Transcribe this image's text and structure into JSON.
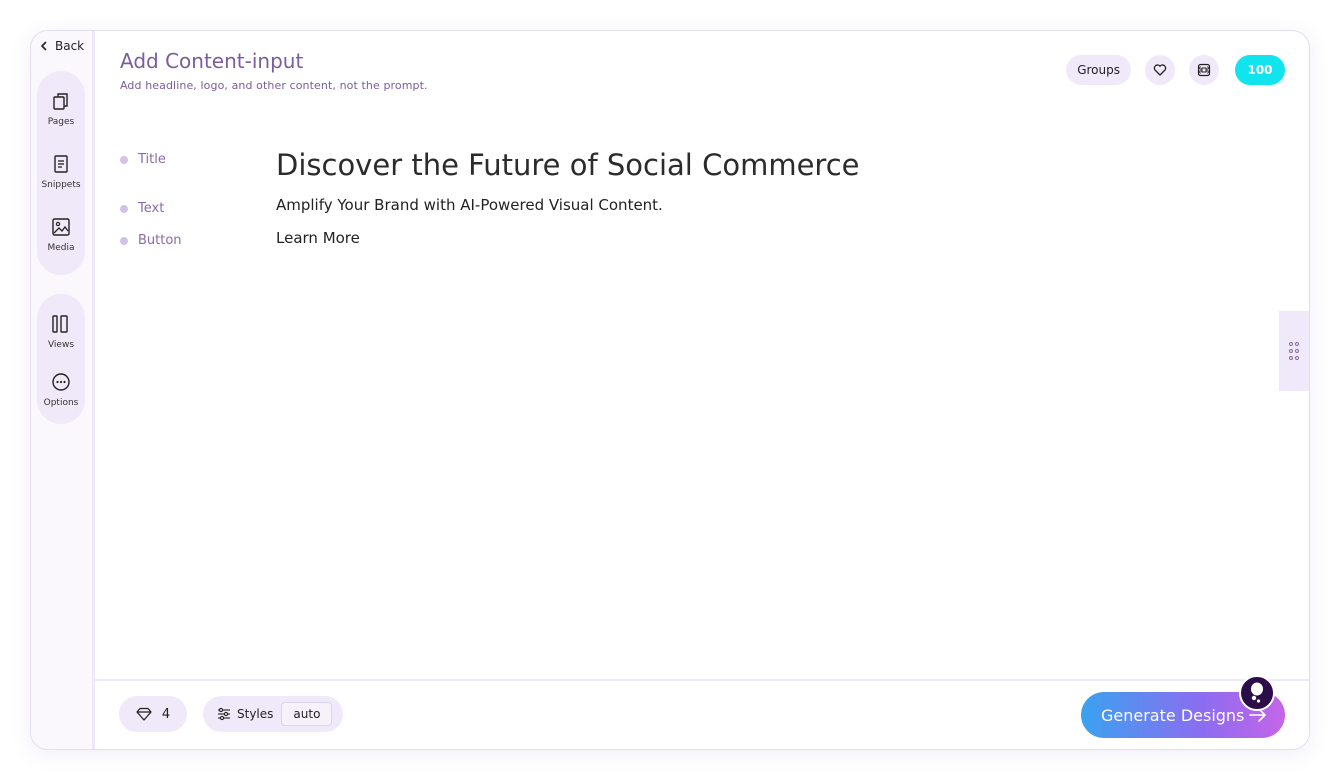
{
  "sidebar": {
    "back_label": "Back",
    "items": [
      {
        "label": "Pages",
        "icon": "copy-pages-icon"
      },
      {
        "label": "Snippets",
        "icon": "document-icon"
      },
      {
        "label": "Media",
        "icon": "image-icon"
      },
      {
        "label": "Views",
        "icon": "columns-icon"
      },
      {
        "label": "Options",
        "icon": "more-horizontal-circle-icon"
      }
    ]
  },
  "header": {
    "title": "Add Content-input",
    "subtitle": "Add headline, logo, and other content, not the prompt.",
    "groups_label": "Groups",
    "credits": "100"
  },
  "fields": [
    {
      "label": "Title",
      "value": "Discover the Future of Social Commerce"
    },
    {
      "label": "Text",
      "value": "Amplify Your Brand with AI-Powered Visual Content."
    },
    {
      "label": "Button",
      "value": "Learn More"
    }
  ],
  "footer": {
    "count": "4",
    "styles_label": "Styles",
    "styles_value": "auto",
    "generate_label": "Generate Designs"
  },
  "colors": {
    "accent_purple": "#7a5d9c",
    "pill_bg": "#f0e9f9",
    "credits_cyan": "#12e4ee",
    "gradient_start": "#3aa2f0",
    "gradient_end": "#c565e8"
  }
}
